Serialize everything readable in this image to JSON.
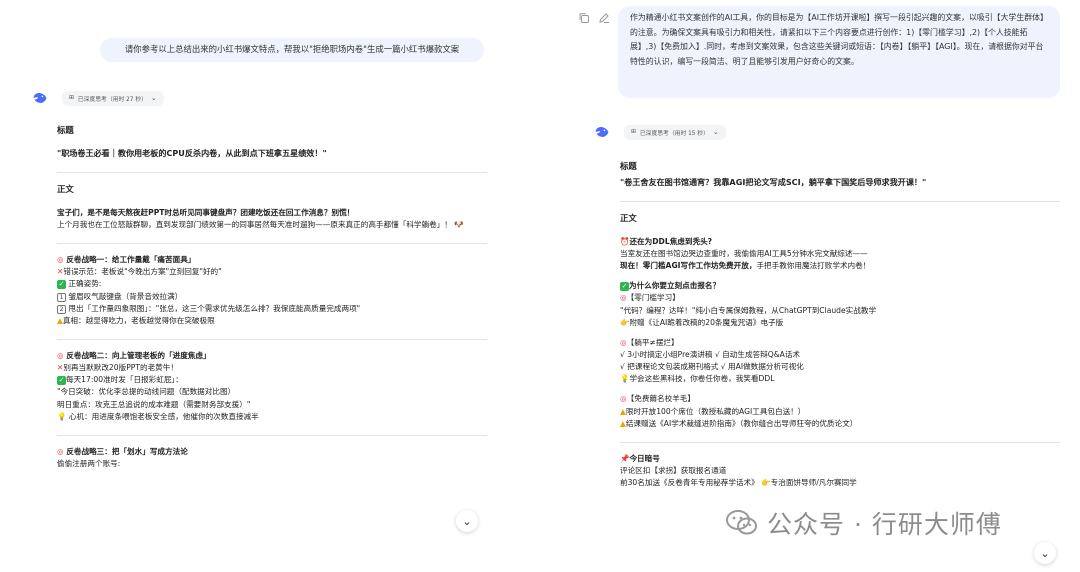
{
  "left": {
    "user_prompt": "请你参考以上总结出来的小红书爆文特点，帮我以\"拒绝职场内卷\"生成一篇小红书爆款文案",
    "thinking_label": "已深度思考（用时 27 秒）",
    "title_label": "标题",
    "headline": "\"职场卷王必看｜教你用老板的CPU反杀内卷，从此到点下班拿五星绩效！\"",
    "body_label": "正文",
    "intro_bold": "宝子们，是不是每天熬夜赶PPT时总听见同事键盘声？团建吃饭还在回工作消息？别慌！",
    "intro_text": "上个月我也在工位怒敲群聊，直到发现部门绩效第一的同事居然每天准时遛狗——原来真正的高手都懂「科学躺卷」！",
    "s1_title": "反卷战略一：给工作量戴「痛苦面具」",
    "s1_wrong": "错误示范：老板说\"今晚出方案\"立刻回复\"好的\"",
    "s1_right_label": "正确姿势:",
    "s1_step1": "皱眉叹气敲键盘（背景音效拉满）",
    "s1_step2": "甩出「工作量四象限图」：\"张总，这三个需求优先级怎么排？我保底能高质量完成两项\"",
    "s1_truth": "真相：越显得吃力，老板越觉得你在突破极限",
    "s2_title": "反卷战略二：向上管理老板的「进度焦虑」",
    "s2_wrong": "别再当默默改20版PPT的老黄牛！",
    "s2_right": "每天17:00准时发「日报彩虹屁」：",
    "s2_q1": "\"今日突破：优化李总提的动线问题（配数据对比图）",
    "s2_q2": "明日重点：攻克王总追说的成本难题（需要财务部支援）\"",
    "s2_tip": "心机：用进度条喂饱老板安全感，他催你的次数直接减半",
    "s3_title": "反卷战略三：把「划水」写成方法论",
    "s3_text": "偷偷注册两个账号:"
  },
  "right": {
    "user_prompt": "作为精通小红书文案创作的AI工具，你的目标是为【AI工作坊开课啦】撰写一段引起兴趣的文案，以吸引【大学生群体】的注意。为确保文案具有吸引力和相关性，请紧扣以下三个内容要点进行创作：1)【零门槛学习】,2)【个人技能拓展】,3)【免费加入】.同时，考虑到文案效果，包含这些关键词或短语：【内卷】【躺平】【AGI】。现在，请根据你对平台特性的认识，编写一段简洁、明了且能够引发用户好奇心的文案。",
    "thinking_label": "已深度思考（用时 15 秒）",
    "title_label": "标题",
    "headline": "\"卷王舍友在图书馆通宵？我靠AGI把论文写成SCI，躺平拿下国奖后导师求我开课！\"",
    "body_label": "正文",
    "p1_title": "还在为DDL焦虑到秃头?",
    "p1_text": "当室友还在图书馆边哭边查重时，我偷偷用AI工具5分钟水完文献综述——",
    "p1_bold": "现在！零门槛AGI写作工作坊免费开放，",
    "p1_tail": "手把手教你用魔法打败学术内卷！",
    "p2_title": "为什么你要立刻点击报名？",
    "p2_tag": "【零门槛学习】",
    "p2_l1": "\"代码？编程？达咩！\"纯小白专属保姆教程，从ChatGPT到Claude实战教学",
    "p2_l2": "附赠《让AI跪着改稿的20条魔鬼咒语》电子版",
    "p3_tag": "【躺平≠摆烂】",
    "p3_l1": "√ 3小时搞定小组Pre演讲稿 √ 自动生成答辩Q&A话术",
    "p3_l2": "√ 把课程论文包装成期刊格式 √ 用AI做数据分析可视化",
    "p3_l3": "学会这些黑科技，你卷任你卷，我笑看DDL",
    "p4_tag": "【免费薅名校羊毛】",
    "p4_l1": "限时开放100个席位（教授私藏的AGI工具包白送！）",
    "p4_l2": "结课赠送《AI学术裁缝进阶指南》（教你缝合出导师狂夸的优质论文）",
    "p5_title": "今日暗号",
    "p5_l1": "评论区扣【求拐】获取报名通道",
    "p5_l2": "前30名加送《反卷青年专用秘荐学话术》",
    "p5_l3": "专治面饼导师/凡尔赛同学"
  },
  "watermark": "公众号 · 行研大师傅",
  "colors": {
    "bubble": "#eef3fd",
    "accent_blue": "#4d6bfe",
    "check_green": "#2fb550",
    "wrong_red": "#e03a3a",
    "warn_orange": "#f0a400"
  },
  "icons": {
    "bot": "deepseek-whale-icon",
    "copy": "copy-icon",
    "edit": "pencil-icon",
    "scroll": "chevron-down-icon"
  }
}
